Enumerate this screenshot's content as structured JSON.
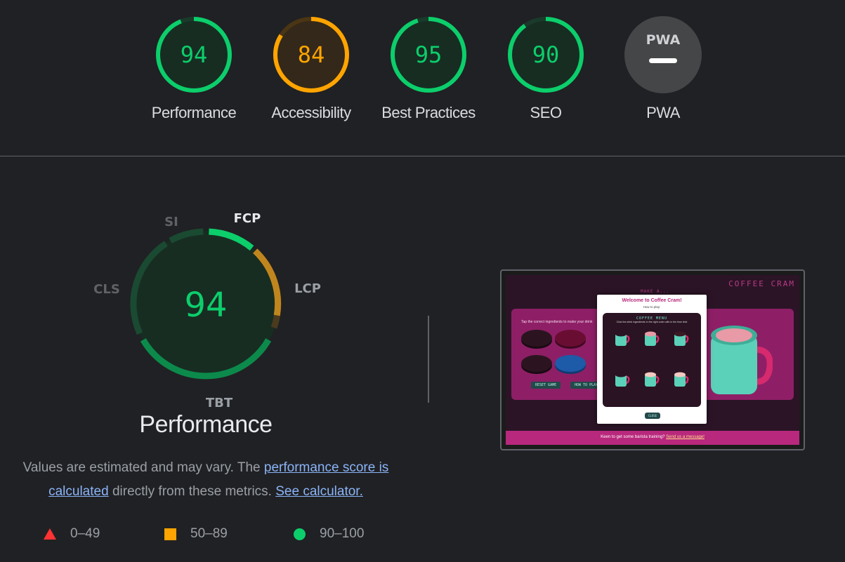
{
  "categories": [
    {
      "id": "performance",
      "score": 94,
      "label": "Performance",
      "color": "#0cce6b"
    },
    {
      "id": "accessibility",
      "score": 84,
      "label": "Accessibility",
      "color": "#ffa400"
    },
    {
      "id": "best_practices",
      "score": 95,
      "label": "Best Practices",
      "color": "#0cce6b"
    },
    {
      "id": "seo",
      "score": 90,
      "label": "SEO",
      "color": "#0cce6b"
    },
    {
      "id": "pwa",
      "badge": "PWA",
      "label": "PWA"
    }
  ],
  "performance": {
    "score": 94,
    "title": "Performance",
    "metric_labels": {
      "si": "SI",
      "fcp": "FCP",
      "lcp": "LCP",
      "tbt": "TBT",
      "cls": "CLS"
    },
    "description": {
      "text1": "Values are estimated and may vary. The ",
      "link1": "performance score is calculated",
      "text2": " directly from these metrics. ",
      "link2": "See calculator."
    }
  },
  "legend": [
    {
      "range": "0–49",
      "shape": "triangle",
      "color": "#ff3333"
    },
    {
      "range": "50–89",
      "shape": "square",
      "color": "#ffa400"
    },
    {
      "range": "90–100",
      "shape": "circle",
      "color": "#0cce6b"
    }
  ],
  "screenshot": {
    "site_title": "COFFEE CRAM",
    "make_a": "MAKE A...",
    "instruction": "Tap the correct ingredients to make your drink",
    "reset_button": "RESET GAME",
    "how_to_button": "HOW TO PLAY",
    "modal_title": "Welcome to Coffee Cram!",
    "modal_subtitle": "How to play:",
    "menu_title": "COFFEE MENU",
    "menu_instruction": "Click the drink ingredients in the right order with in the time limit",
    "close_button": "CLOSE",
    "footer_text": "Keen to get some barista training? ",
    "footer_link": "Send us a message!"
  }
}
